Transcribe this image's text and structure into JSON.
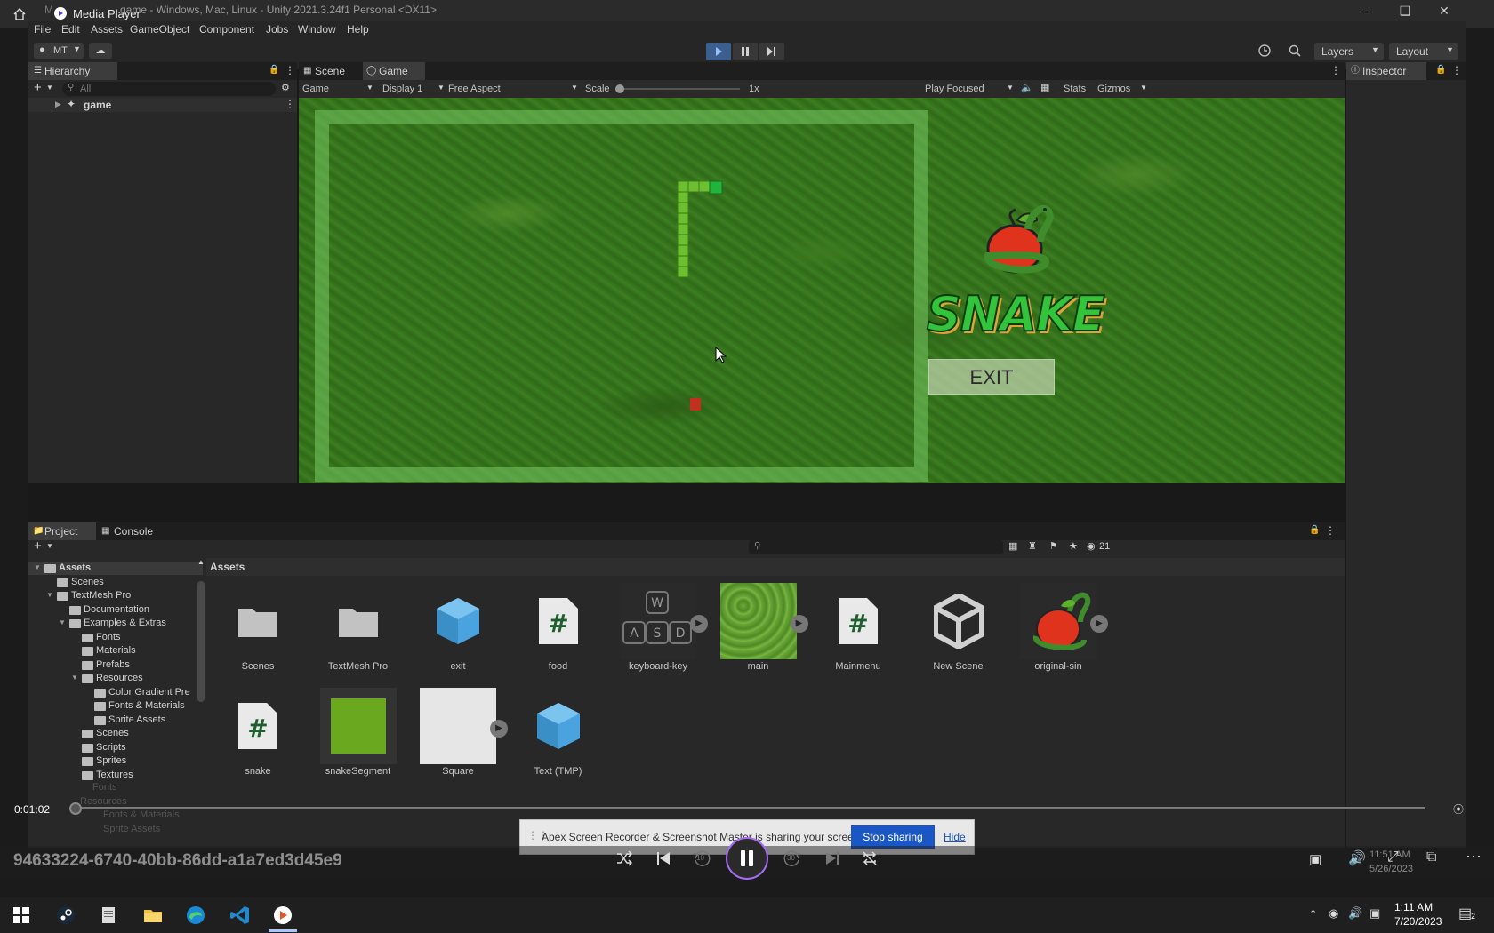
{
  "media_player": {
    "title": "Media Player",
    "ghost_title": "M",
    "time": "0:01:02",
    "filename": "94633224-6740-40bb-86dd-a1a7ed3d45e9",
    "controls": [
      "shuffle",
      "previous",
      "rewind-10",
      "pause",
      "forward-30",
      "next",
      "repeat"
    ],
    "rewind_label": "10",
    "forward_label": "30"
  },
  "unity": {
    "window_title": "game - Windows, Mac, Linux - Unity 2021.3.24f1 Personal <DX11>",
    "menu": [
      "File",
      "Edit",
      "Assets",
      "GameObject",
      "Component",
      "Jobs",
      "Window",
      "Help"
    ],
    "account": "MT",
    "layers": "Layers",
    "layout": "Layout",
    "hierarchy": {
      "tab": "Hierarchy",
      "search_placeholder": "All",
      "root": "game"
    },
    "scene_tabs": [
      "Scene",
      "Game"
    ],
    "game_toolbar": {
      "mode": "Game",
      "display": "Display 1",
      "aspect": "Free Aspect",
      "scale_label": "Scale",
      "scale_value": "1x",
      "play_focused": "Play Focused",
      "stats": "Stats",
      "gizmos": "Gizmos"
    },
    "game": {
      "title": "SNAKE",
      "exit_button": "EXIT",
      "colors": {
        "snake_head": "#22b33a",
        "snake_body": "#6cbf2f",
        "food": "#c0321f",
        "border": "#6fbd5a"
      }
    },
    "inspector": {
      "tab": "Inspector"
    },
    "project": {
      "tabs": [
        "Project",
        "Console"
      ],
      "hidden_count": "21",
      "breadcrumb": "Assets",
      "tree": [
        {
          "label": "Assets",
          "level": 0
        },
        {
          "label": "Scenes",
          "level": 1
        },
        {
          "label": "TextMesh Pro",
          "level": 1
        },
        {
          "label": "Documentation",
          "level": 2
        },
        {
          "label": "Examples & Extras",
          "level": 2
        },
        {
          "label": "Fonts",
          "level": 3
        },
        {
          "label": "Materials",
          "level": 3
        },
        {
          "label": "Prefabs",
          "level": 3
        },
        {
          "label": "Resources",
          "level": 3
        },
        {
          "label": "Color Gradient Pre",
          "level": 4
        },
        {
          "label": "Fonts & Materials",
          "level": 4
        },
        {
          "label": "Sprite Assets",
          "level": 4
        },
        {
          "label": "Scenes",
          "level": 3
        },
        {
          "label": "Scripts",
          "level": 3
        },
        {
          "label": "Sprites",
          "level": 3
        },
        {
          "label": "Textures",
          "level": 3
        }
      ],
      "tree_ghost": [
        "Fonts",
        "Resources",
        "Fonts & Materials",
        "Sprite Assets"
      ],
      "assets": [
        {
          "name": "Scenes",
          "icon": "folder-icon"
        },
        {
          "name": "TextMesh Pro",
          "icon": "folder-icon"
        },
        {
          "name": "exit",
          "icon": "prefab-cube-icon"
        },
        {
          "name": "food",
          "icon": "csharp-script-icon"
        },
        {
          "name": "keyboard-key",
          "icon": "keyboard-keys-sprite"
        },
        {
          "name": "main",
          "icon": "grass-texture"
        },
        {
          "name": "Mainmenu",
          "icon": "csharp-script-icon"
        },
        {
          "name": "New Scene",
          "icon": "unity-scene-icon"
        },
        {
          "name": "original-sin",
          "icon": "snake-apple-sprite"
        },
        {
          "name": "snake",
          "icon": "csharp-script-icon"
        },
        {
          "name": "snakeSegment",
          "icon": "green-square-sprite"
        },
        {
          "name": "Square",
          "icon": "white-square-sprite"
        },
        {
          "name": "Text (TMP)",
          "icon": "prefab-cube-icon"
        }
      ]
    }
  },
  "share_bar": {
    "message": "Apex Screen Recorder & Screenshot Master is sharing your screen.",
    "stop_button": "Stop sharing",
    "hide_link": "Hide"
  },
  "ghost_taskbar": {
    "time": "11:51 AM",
    "date": "5/26/2023"
  },
  "taskbar": {
    "time": "1:11 AM",
    "date": "7/20/2023",
    "apps": [
      "start",
      "steam",
      "notepad",
      "file-explorer",
      "edge",
      "vscode",
      "media-player"
    ],
    "notification_count": "2"
  }
}
